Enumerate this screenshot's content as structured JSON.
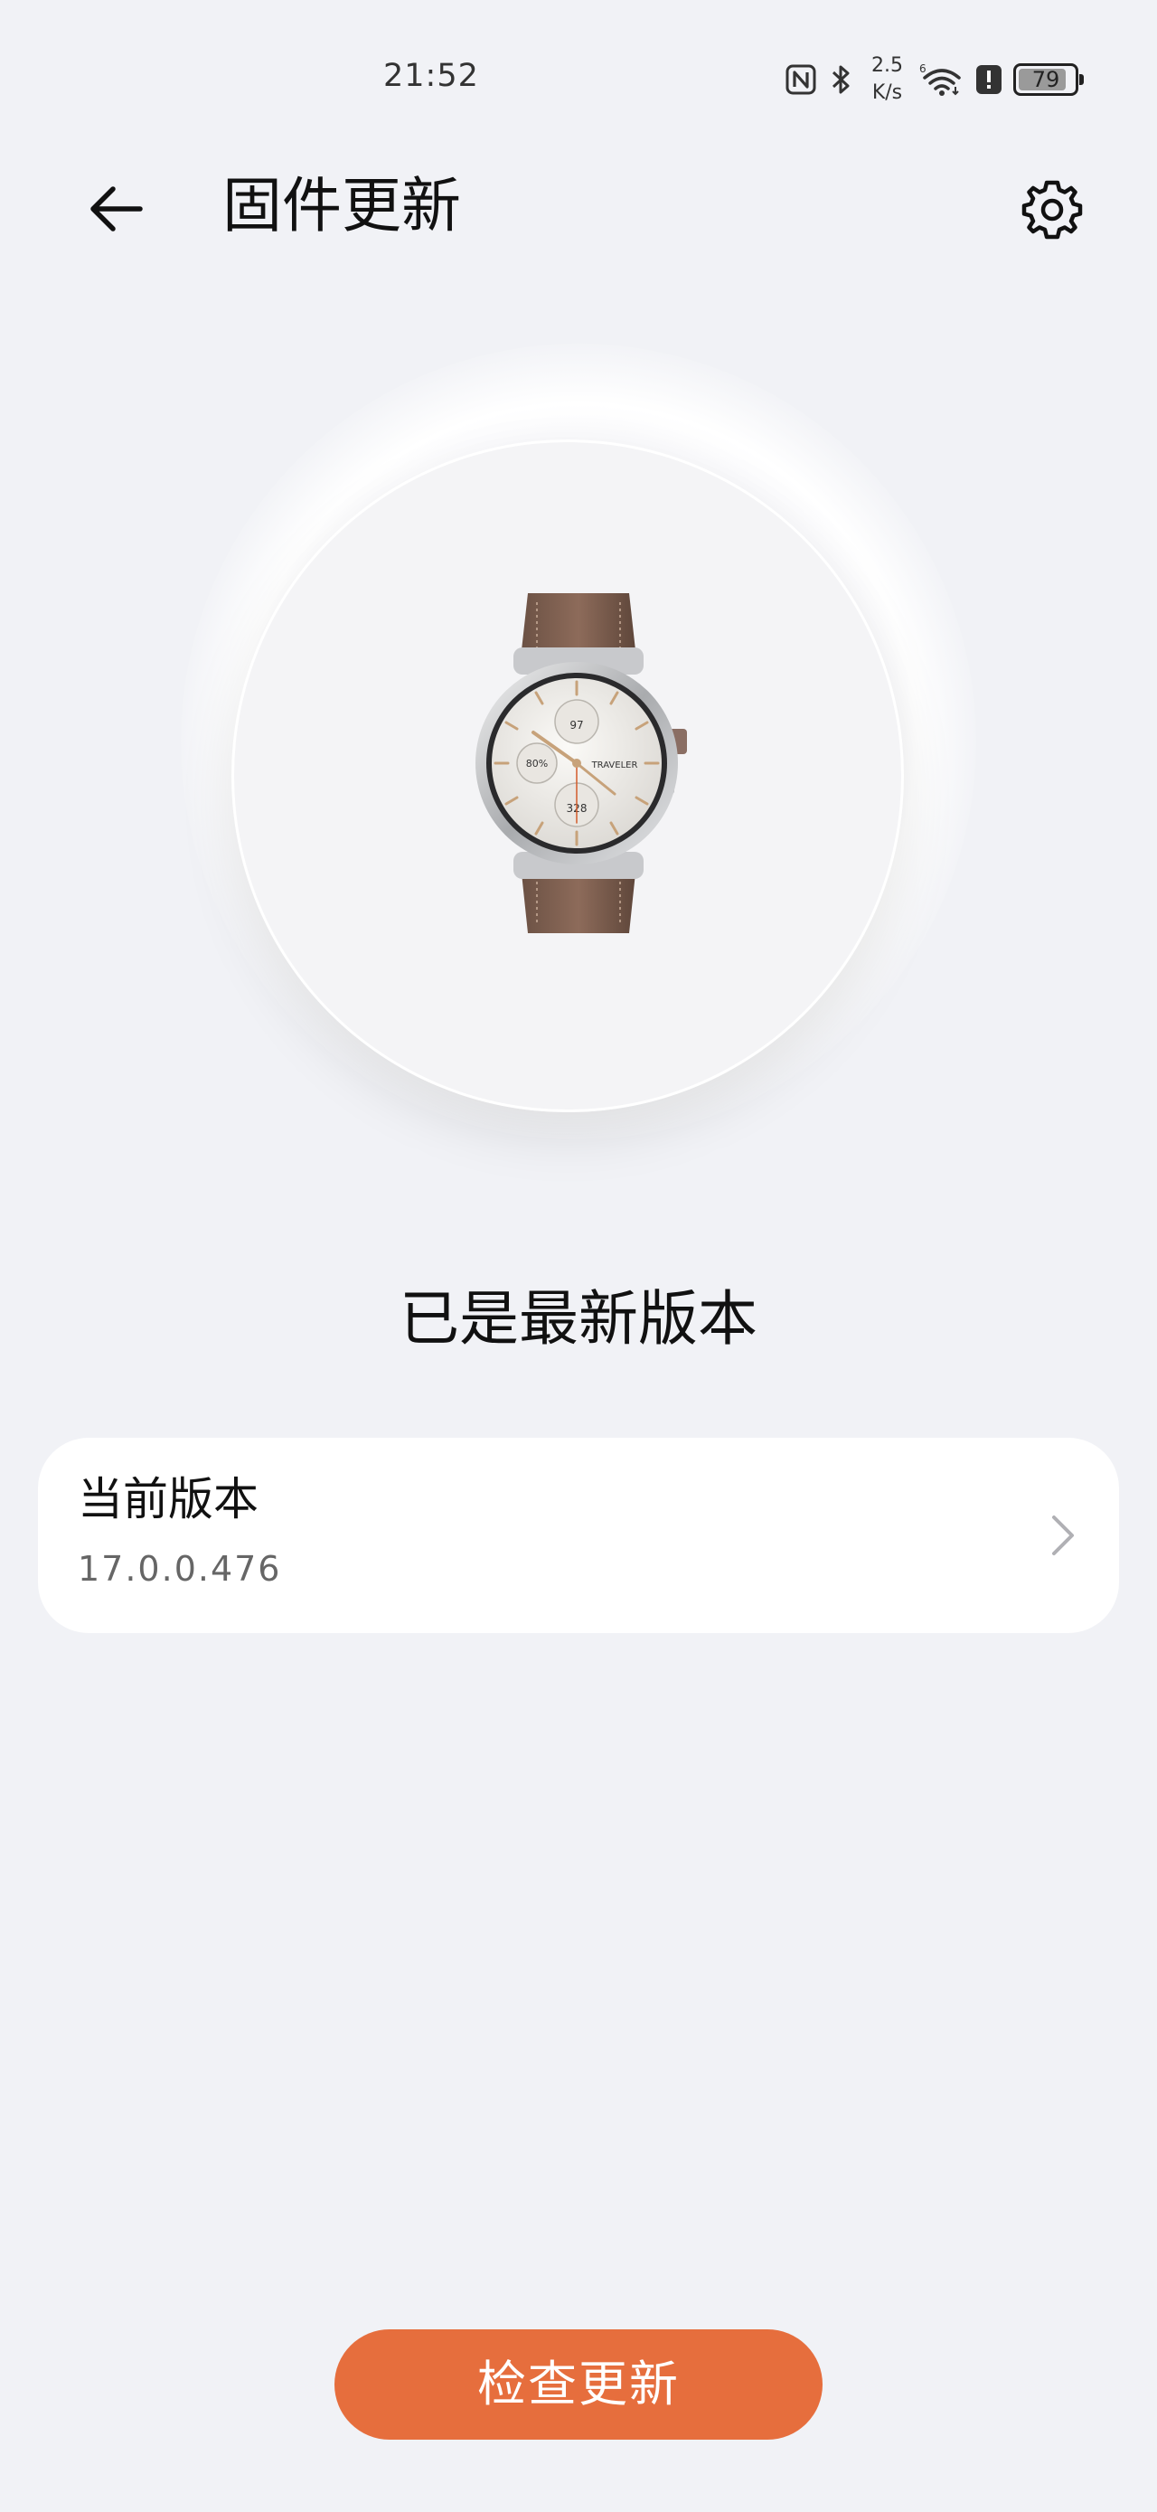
{
  "status_bar": {
    "time": "21:52",
    "net_speed_value": "2.5",
    "net_speed_unit": "K/s",
    "battery_level": "79",
    "icons": [
      "nfc-icon",
      "bluetooth-icon",
      "wifi-icon",
      "alert-icon",
      "battery-icon"
    ]
  },
  "header": {
    "title": "固件更新",
    "back_icon": "arrow-left-icon",
    "settings_icon": "gear-icon"
  },
  "device": {
    "image": "smartwatch-image",
    "watch_face_text": "TRAVELER",
    "watch_face_top": "97",
    "watch_face_left": "80%",
    "watch_face_bottom": "328"
  },
  "main": {
    "status": "已是最新版本"
  },
  "version_card": {
    "label": "当前版本",
    "value": "17.0.0.476",
    "chevron_icon": "chevron-right-icon"
  },
  "actions": {
    "check_update": "检查更新"
  },
  "colors": {
    "accent": "#e66e3d",
    "background": "#f1f2f6",
    "card": "#ffffff"
  }
}
